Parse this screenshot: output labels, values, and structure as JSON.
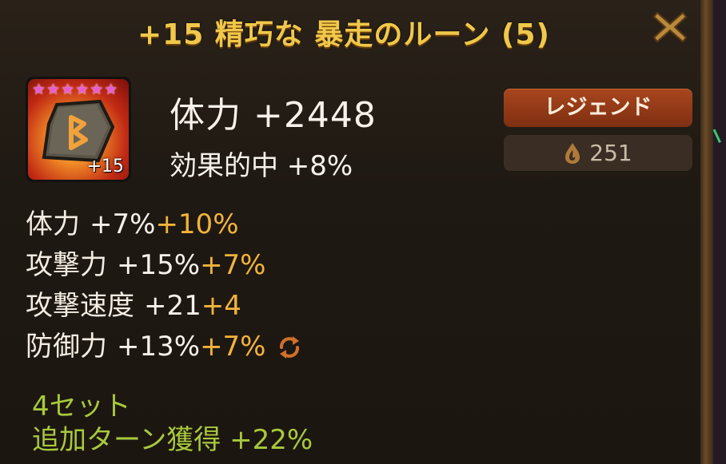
{
  "title": "+15 精巧な 暴走のルーン (5)",
  "close_icon": "close-x-icon",
  "rune": {
    "stars": 6,
    "star_color": "#e85bd7",
    "level_label": "+15",
    "icon": "rune-stone-icon"
  },
  "main_stat": "体力 +2448",
  "innate_stat": "効果的中 +8%",
  "grade": "レジェンド",
  "sell_value": "251",
  "sell_icon": "mana-crystal-icon",
  "substats": [
    {
      "label": "体力",
      "value": "+7%",
      "bonus": "+10%",
      "reroll": false
    },
    {
      "label": "攻撃力",
      "value": "+15%",
      "bonus": "+7%",
      "reroll": false
    },
    {
      "label": "攻撃速度",
      "value": "+21",
      "bonus": "+4",
      "reroll": false
    },
    {
      "label": "防御力",
      "value": "+13%",
      "bonus": "+7%",
      "reroll": true
    }
  ],
  "set": {
    "count": "4セット",
    "effect": "追加ターン獲得 +22%"
  },
  "colors": {
    "title": "#f0c84a",
    "bonus": "#f2b33a",
    "set": "#a8c93c",
    "grade_badge": "#8f3a16"
  }
}
